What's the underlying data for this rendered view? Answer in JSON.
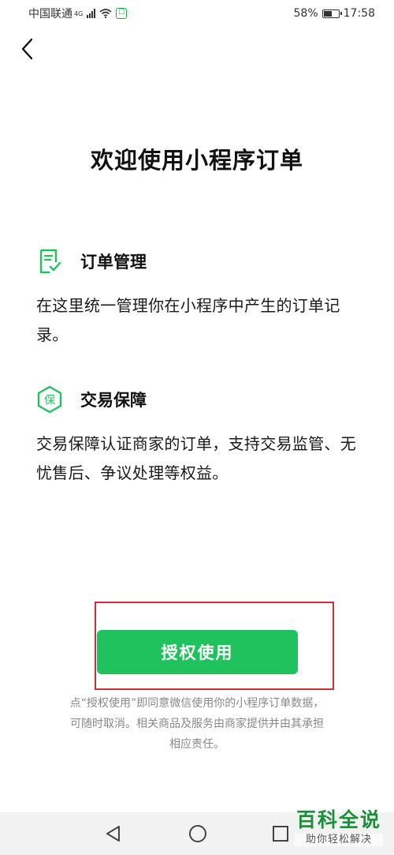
{
  "status_bar": {
    "carrier": "中国联通",
    "network": "4G",
    "battery": "58%",
    "battery_level": 0.58,
    "time": "17:58"
  },
  "icons": {
    "back": "chevron-left-icon",
    "order": "order-list-icon",
    "protection": "shield-protect-icon"
  },
  "page": {
    "title": "欢迎使用小程序订单"
  },
  "features": [
    {
      "title": "订单管理",
      "description": "在这里统一管理你在小程序中产生的订单记录。"
    },
    {
      "title": "交易保障",
      "icon_text": "保",
      "description": "交易保障认证商家的订单，支持交易监管、无忧售后、争议处理等权益。"
    }
  ],
  "authorize_button": {
    "label": "授权使用"
  },
  "disclaimer": {
    "line1": "点“授权使用”即同意微信使用你的小程序订单数据，",
    "line2": "可随时取消。相关商品及服务由商家提供并由其承担",
    "line3": "相应责任。"
  },
  "watermark": {
    "main": "百科全说",
    "sub": "助你轻松解决"
  },
  "colors": {
    "accent": "#1fc25d",
    "highlight": "#c8313a",
    "watermark": "#1c8f3b"
  }
}
